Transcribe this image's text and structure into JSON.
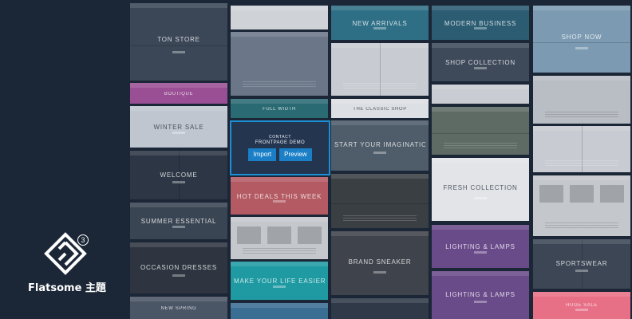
{
  "brand": {
    "name": "Flatsome 主題",
    "version_badge": "3",
    "logo_icon": "flatsome-diamond-logo-icon"
  },
  "active_demo": {
    "line1": "CONTACT",
    "line2": "FRONTPAGE DEMO",
    "import_label": "Import",
    "preview_label": "Preview"
  },
  "colors": {
    "page_bg": "#1b2636",
    "accent": "#1e8fd5",
    "button": "#1a7fc6"
  },
  "demo_tiles": [
    {
      "name": "ton-store",
      "title": "TON STORE",
      "bg": "#3b4757",
      "style": "watches"
    },
    {
      "name": "minimal-white",
      "title": "",
      "bg": "#cfd3d8",
      "style": "light"
    },
    {
      "name": "new-arrivals",
      "title": "NEW ARRIVALS",
      "bg": "#2f6f86",
      "style": "banner"
    },
    {
      "name": "modern-business",
      "title": "MODERN BUSINESS",
      "bg": "#2b5c72",
      "style": "banner"
    },
    {
      "name": "gradient-shop",
      "title": "",
      "bg": "#6b7688",
      "style": "plain"
    },
    {
      "name": "shop-now",
      "title": "SHOP NOW",
      "bg": "#7c9bb2",
      "style": "city"
    },
    {
      "name": "default-shop",
      "title": "",
      "bg": "#b9bdc4",
      "style": "light"
    },
    {
      "name": "sale-fashion",
      "title": "",
      "bg": "#c8ccd2",
      "style": "model"
    },
    {
      "name": "shop-collection",
      "title": "SHOP COLLECTION",
      "bg": "#3e4a5a",
      "style": "banner"
    },
    {
      "name": "pink-boutique",
      "title": "BOUTIQUE",
      "bg": "#9a4f95",
      "style": "banner"
    },
    {
      "name": "full-width",
      "title": "FULL WIDTH",
      "bg": "#2a6a73",
      "style": "banner"
    },
    {
      "name": "the-classic-shop",
      "title": "THE CLASSIC SHOP",
      "bg": "#dcdfe3",
      "style": "light"
    },
    {
      "name": "the-mountains",
      "title": "",
      "bg": "#5d6b64",
      "style": "landscape"
    },
    {
      "name": "winter-sale",
      "title": "WINTER SALE",
      "bg": "#c0c6cf",
      "style": "light"
    },
    {
      "name": "lifestyle",
      "title": "",
      "bg": "#c9ccd2",
      "style": "light"
    },
    {
      "name": "start-your-imagination",
      "title": "START YOUR IMAGINATION",
      "bg": "#4f5c6a",
      "style": "banner"
    },
    {
      "name": "clean-shop",
      "title": "",
      "bg": "#3a3f44",
      "style": "landscape"
    },
    {
      "name": "welcome",
      "title": "WELCOME",
      "bg": "#2c3644",
      "style": "split"
    },
    {
      "name": "hot-deals",
      "title": "HOT DEALS THIS WEEK",
      "bg": "#b45a63",
      "style": "banner"
    },
    {
      "name": "fresh-collection",
      "title": "FRESH COLLECTION",
      "bg": "#e2e4e7",
      "style": "light"
    },
    {
      "name": "summer-essential",
      "title": "SUMMER ESSENTIAL",
      "bg": "#3a4553",
      "style": "banner"
    },
    {
      "name": "travel-grid",
      "title": "",
      "bg": "#c4c7cc",
      "style": "grid"
    },
    {
      "name": "sportswear",
      "title": "SPORTSWEAR",
      "bg": "#3c4655",
      "style": "split"
    },
    {
      "name": "occasion-dresses",
      "title": "OCCASION DRESSES",
      "bg": "#2f3540",
      "style": "banner"
    },
    {
      "name": "make-your-life-easier",
      "title": "MAKE YOUR LIFE EASIER",
      "bg": "#1f9aa2",
      "style": "banner"
    },
    {
      "name": "brand-sneaker",
      "title": "BRAND SNEAKER",
      "bg": "#3f434b",
      "style": "banner"
    },
    {
      "name": "lighting-lamps",
      "title": "LIGHTING & LAMPS",
      "bg": "#6a4b8a",
      "style": "banner"
    },
    {
      "name": "huge-sale",
      "title": "HUGE SALE",
      "bg": "#e76f86",
      "style": "banner"
    },
    {
      "name": "new-spring",
      "title": "NEW SPRING",
      "bg": "#4a5566",
      "style": "banner"
    },
    {
      "name": "bottom-blue",
      "title": "",
      "bg": "#3b6e93",
      "style": "plain"
    },
    {
      "name": "dark-collection",
      "title": "",
      "bg": "#2f3948",
      "style": "plain"
    }
  ]
}
